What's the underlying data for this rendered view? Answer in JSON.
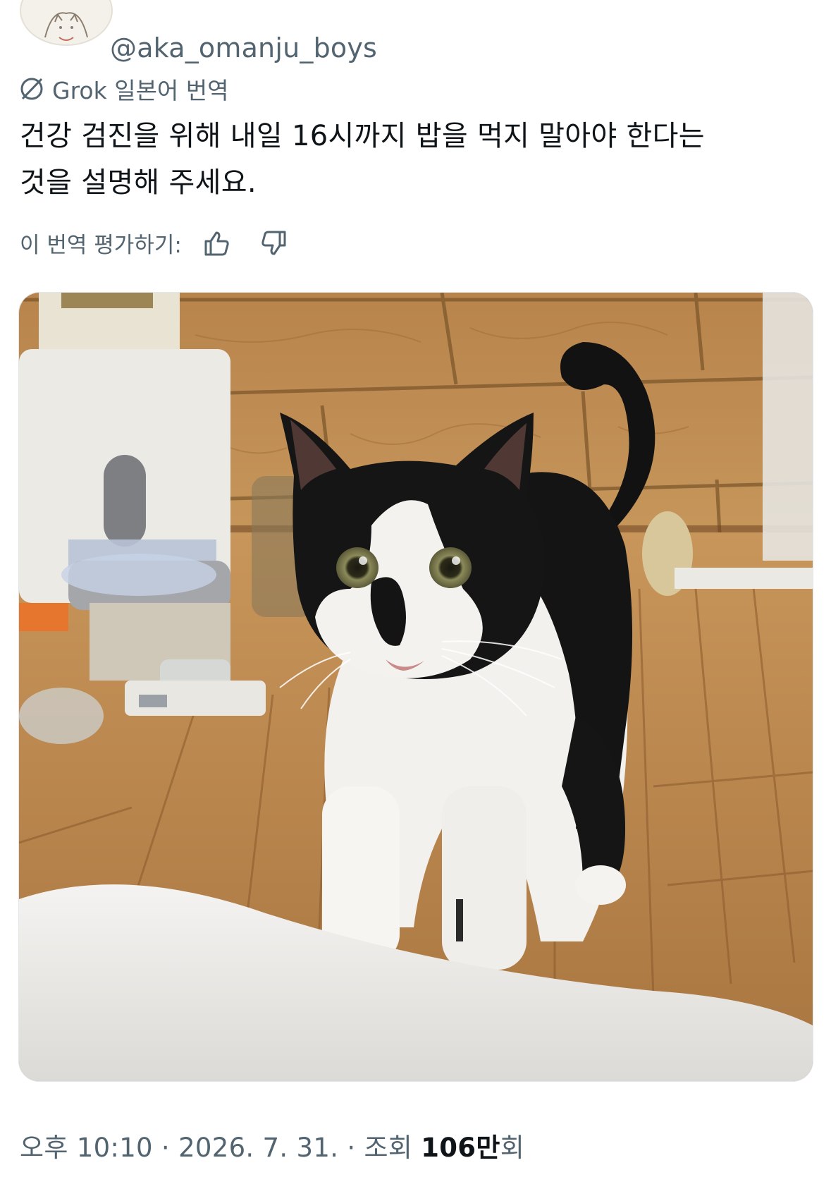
{
  "author": {
    "handle": "@aka_omanju_boys",
    "avatar_icon": "cat-drawing-avatar"
  },
  "translation": {
    "icon": "grok-icon",
    "label": "Grok 일본어 번역"
  },
  "tweet": {
    "line1": "건강 검진을 위해 내일 16시까지 밥을 먹지 말아야 한다는",
    "line2": "것을 설명해 주세요."
  },
  "rating": {
    "label": "이 번역 평가하기:",
    "up_icon": "thumbs-up-icon",
    "down_icon": "thumbs-down-icon"
  },
  "media": {
    "subject": "tuxedo cat photo"
  },
  "meta": {
    "time": "오후 10:10",
    "sep1": " · ",
    "date": "2026. 7. 31.",
    "sep2": " · ",
    "views_label": "조회 ",
    "views_count": "106만",
    "views_suffix": "회"
  },
  "colors": {
    "text_primary": "#0f1419",
    "text_secondary": "#536471",
    "floor": "#b8874c",
    "wall": "#c99a5e"
  }
}
